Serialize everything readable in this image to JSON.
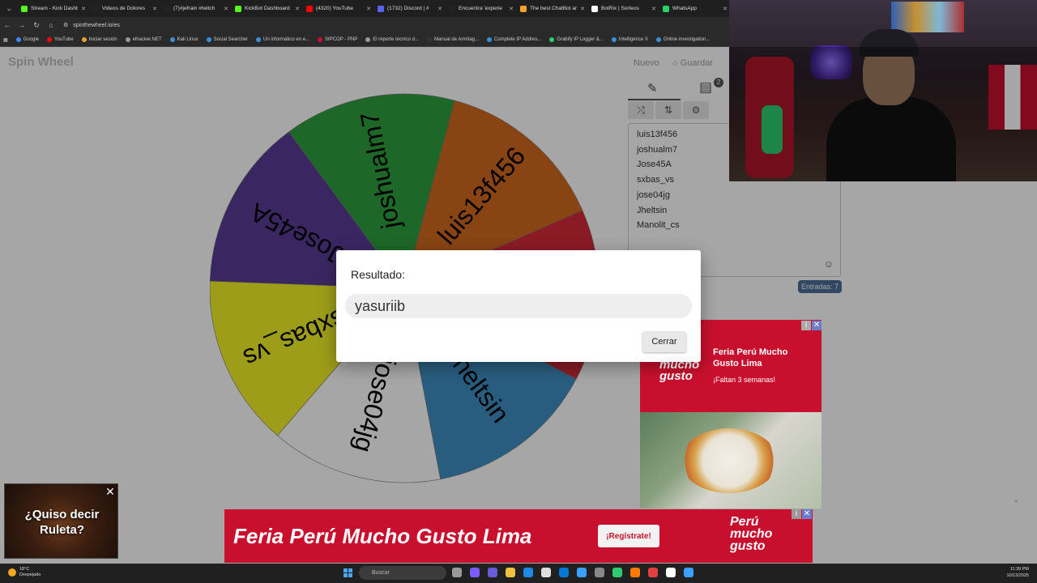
{
  "browser": {
    "tabs": [
      {
        "label": "Stream - Kick Dashb",
        "color": "#53fc18"
      },
      {
        "label": "Videos de Dolores",
        "color": "#222222"
      },
      {
        "label": "(7)#jefrain #twitch",
        "color": "#222222"
      },
      {
        "label": "KickBot Dashboard",
        "color": "#53fc18"
      },
      {
        "label": "(4320) YouTube",
        "color": "#ff0000"
      },
      {
        "label": "(1732) Discord | #",
        "color": "#5865f2"
      },
      {
        "label": "Encuentra 'experie",
        "color": "#222222"
      },
      {
        "label": "The best ChatBot ar",
        "color": "#f5a623"
      },
      {
        "label": "BotRix | Sorteos",
        "color": "#ffffff"
      },
      {
        "label": "WhatsApp",
        "color": "#25d366"
      }
    ],
    "url": "spinthewheel.io/es",
    "bookmarks": [
      {
        "label": "Google",
        "color": "#4285f4"
      },
      {
        "label": "YouTube",
        "color": "#ff0000"
      },
      {
        "label": "Iniciar sesión",
        "color": "#e7a52b"
      },
      {
        "label": "elhacker.NET",
        "color": "#999999"
      },
      {
        "label": "Kali Linux",
        "color": "#3b8fd6"
      },
      {
        "label": "Social Searcher",
        "color": "#3b8fd6"
      },
      {
        "label": "Un informático en e...",
        "color": "#3b8fd6"
      },
      {
        "label": "SIPCOP - PNP",
        "color": "#c8102e"
      },
      {
        "label": "El reporte técnico d...",
        "color": "#999999"
      },
      {
        "label": "Manual de Armitag...",
        "color": "#333333"
      },
      {
        "label": "Complete IP Addres...",
        "color": "#3b8fd6"
      },
      {
        "label": "Grabify IP Logger &...",
        "color": "#2ecc71"
      },
      {
        "label": "Intelligence X",
        "color": "#3b8fd6"
      },
      {
        "label": "Online investigation...",
        "color": "#3b8fd6"
      }
    ]
  },
  "app": {
    "logo": "Spin Wheel",
    "new_label": "Nuevo",
    "save_label": "Guardar",
    "results_badge": "2"
  },
  "wheel": {
    "segments": [
      {
        "label": "luis13f456",
        "color": "#d2691e"
      },
      {
        "label": "Manolit_cs",
        "color": "#d42a3a"
      },
      {
        "label": "Jheltsin",
        "color": "#3f8fc4"
      },
      {
        "label": "jose04jg",
        "color": "#ffffff"
      },
      {
        "label": "sxbas_vs",
        "color": "#f2f227"
      },
      {
        "label": "Jose45A",
        "color": "#5a3d97"
      },
      {
        "label": "joshualm7",
        "color": "#2d9f3e"
      }
    ]
  },
  "entries": [
    "luis13f456",
    "joshualm7",
    "Jose45A",
    "sxbas_vs",
    "jose04jg",
    "Jheltsin",
    "Manolit_cs"
  ],
  "entry_count": "Entradas: 7",
  "dialog": {
    "title": "Resultado:",
    "result": "yasuriib",
    "close_label": "Cerrar"
  },
  "ad_right": {
    "title": "Feria Perú Mucho Gusto Lima",
    "subtitle": "¡Faltan 3 semanas!",
    "logo_top": "mucho",
    "logo_bottom": "gusto"
  },
  "ad_bottom": {
    "headline": "Feria Perú Mucho Gusto Lima",
    "cta": "¡Regístrate!",
    "logo_line1": "Perú",
    "logo_line2": "mucho",
    "logo_line3": "gusto"
  },
  "roulette_ad": {
    "text1": "¿Quiso decir",
    "text2": "Ruleta?"
  },
  "taskbar": {
    "temp": "18°C",
    "weather": "Despejado",
    "search_placeholder": "Buscar",
    "time": "11:39 PM",
    "date": "10/13/2025"
  }
}
